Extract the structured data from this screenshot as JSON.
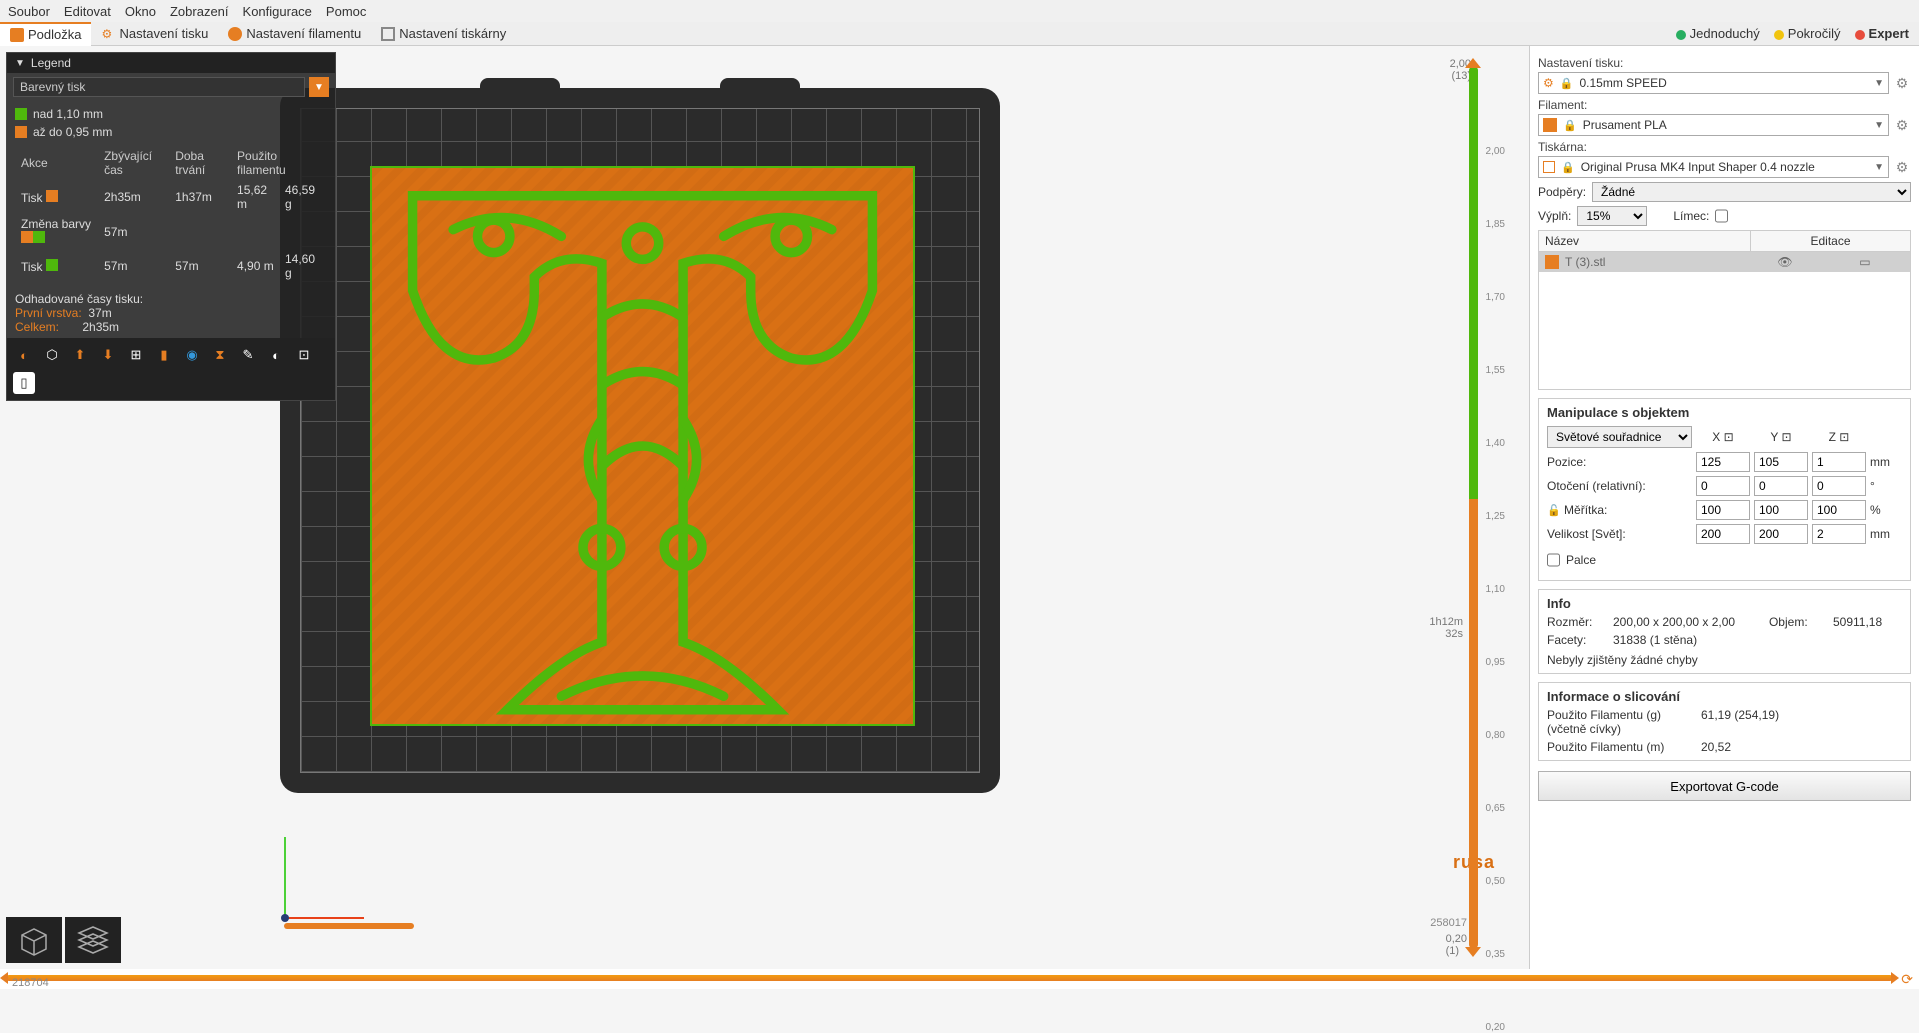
{
  "menu": [
    "Soubor",
    "Editovat",
    "Okno",
    "Zobrazení",
    "Konfigurace",
    "Pomoc"
  ],
  "tabs": [
    {
      "label": "Podložka",
      "active": true,
      "color": "#e67e22"
    },
    {
      "label": "Nastavení tisku",
      "color": "#888"
    },
    {
      "label": "Nastavení filamentu",
      "color": "#e67e22"
    },
    {
      "label": "Nastavení tiskárny",
      "color": "#888"
    }
  ],
  "modes": [
    {
      "label": "Jednoduchý",
      "color": "#27ae60"
    },
    {
      "label": "Pokročilý",
      "color": "#f1c40f"
    },
    {
      "label": "Expert",
      "color": "#e74c3c",
      "active": true
    }
  ],
  "legend": {
    "title": "Legend",
    "dropdown": "Barevný tisk",
    "items": [
      {
        "color": "#4fb80c",
        "label": "nad 1,10 mm"
      },
      {
        "color": "#e67e22",
        "label": "až do 0,95 mm"
      }
    ],
    "table": {
      "headers": [
        "Akce",
        "Zbývající čas",
        "Doba trvání",
        "Použito filamentu"
      ],
      "rows": [
        {
          "name": "Tisk",
          "swatch": "#e67e22",
          "remain": "2h35m",
          "dur": "1h37m",
          "len": "15,62 m",
          "wt": "46,59 g"
        },
        {
          "name": "Změna barvy",
          "swatch": "#e67e22",
          "swatch2": "#4fb80c",
          "remain": "57m",
          "dur": "",
          "len": "",
          "wt": ""
        },
        {
          "name": "Tisk",
          "swatch": "#4fb80c",
          "remain": "57m",
          "dur": "57m",
          "len": "4,90 m",
          "wt": "14,60 g"
        }
      ]
    },
    "estimates_label": "Odhadované časy tisku:",
    "first_layer_label": "První vrstva:",
    "first_layer": "37m",
    "total_label": "Celkem:",
    "total": "2h35m"
  },
  "layer_ticks": [
    "2,00",
    "1,85",
    "1,70",
    "1,55",
    "1,40",
    "1,25",
    "1,10",
    "0,95",
    "0,80",
    "0,65",
    "0,50",
    "0,35",
    "0,20"
  ],
  "layer_top_main": "2,00",
  "layer_top_sub": "(13)",
  "layer_mid_l1": "1h12m",
  "layer_mid_l2": "32s",
  "layer_bot_main": "0,20",
  "layer_bot_sub": "(1)",
  "brand": "rusa",
  "yaxis_label": "258017",
  "presets": {
    "print_label": "Nastavení tisku:",
    "print": "0.15mm SPEED",
    "filament_label": "Filament:",
    "filament": "Prusament PLA",
    "filament_color": "#e67e22",
    "printer_label": "Tiskárna:",
    "printer": "Original Prusa MK4 Input Shaper 0.4 nozzle",
    "supports_label": "Podpěry:",
    "supports": "Žádné",
    "infill_label": "Výplň:",
    "infill": "15%",
    "brim_label": "Límec:"
  },
  "objects": {
    "col1": "Název",
    "col2": "Editace",
    "row_name": "T (3).stl"
  },
  "manip": {
    "title": "Manipulace s objektem",
    "coord_mode": "Světové souřadnice",
    "axes": [
      "X",
      "Y",
      "Z"
    ],
    "rows": [
      {
        "label": "Pozice:",
        "vals": [
          "125",
          "105",
          "1"
        ],
        "unit": "mm"
      },
      {
        "label": "Otočení (relativní):",
        "vals": [
          "0",
          "0",
          "0"
        ],
        "unit": "°"
      },
      {
        "label": "Měřítka:",
        "vals": [
          "100",
          "100",
          "100"
        ],
        "unit": "%",
        "lock": true
      },
      {
        "label": "Velikost [Svět]:",
        "vals": [
          "200",
          "200",
          "2"
        ],
        "unit": "mm"
      }
    ],
    "inches": "Palce"
  },
  "info": {
    "title": "Info",
    "size_label": "Rozměr:",
    "size": "200,00 x 200,00 x 2,00",
    "volume_label": "Objem:",
    "volume": "50911,18",
    "facets_label": "Facety:",
    "facets": "31838 (1 stěna)",
    "errors": "Nebyly zjištěny žádné chyby"
  },
  "slicing_info": {
    "title": "Informace o slicování",
    "rows": [
      {
        "label": "Použito Filamentu (g) (včetně cívky)",
        "val": "61,19 (254,19)"
      },
      {
        "label": "Použito Filamentu (m)",
        "val": "20,52"
      }
    ]
  },
  "export_label": "Exportovat G-code",
  "bottom_num": "218704"
}
